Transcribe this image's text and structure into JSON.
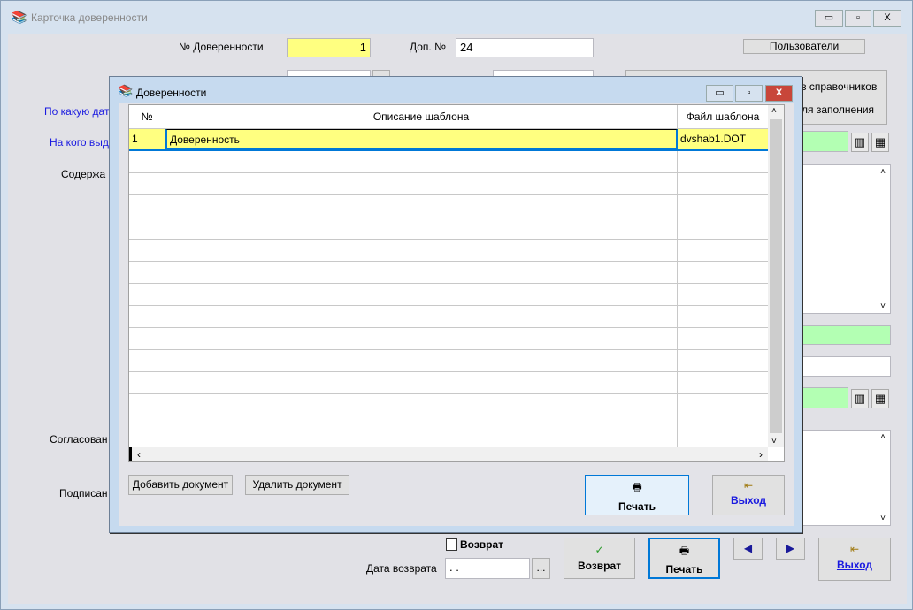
{
  "main_window": {
    "title": "Карточка доверенности",
    "minimize": "▭",
    "maximize": "▫",
    "close": "X"
  },
  "form": {
    "number_label": "№ Доверенности",
    "number_value": "1",
    "extra_number_label": "Доп. №",
    "extra_number_value": "24",
    "users_button": "Пользователи",
    "panel_text_1": "з справочников",
    "panel_text_2": "ля заполнения",
    "label_date_partial": "По какую дат",
    "label_issued_partial": "На кого выда",
    "label_content_partial": "Содержа",
    "label_agreed_partial": "Согласован",
    "label_signed_partial": "Подписан",
    "return_checkbox": "Возврат",
    "return_date_label": "Дата возврата",
    "return_date_value": " . .",
    "ellipsis_button": "...",
    "return_button": "Возврат",
    "print_button": "Печать",
    "exit_button": "Выход"
  },
  "dialog": {
    "title": "Доверенности",
    "columns": [
      "№",
      "Описание шаблона",
      "Файл шаблона"
    ],
    "rows": [
      {
        "num": "1",
        "description": "Доверенность",
        "file": "dvshab1.DOT"
      }
    ],
    "add_button": "Добавить документ",
    "delete_button": "Удалить документ",
    "print_button": "Печать",
    "exit_button": "Выход"
  },
  "colors": {
    "highlight": "#ffff80",
    "green_field": "#b3ffb3",
    "link": "#1a1ae0"
  }
}
